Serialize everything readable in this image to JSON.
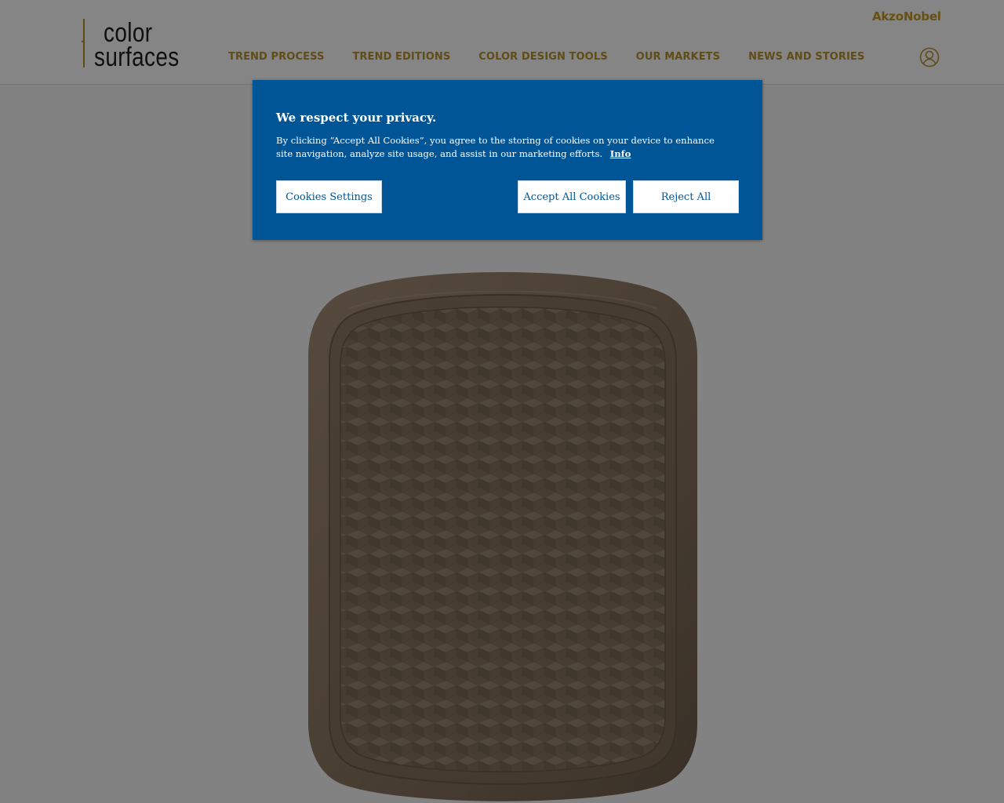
{
  "header": {
    "logo": {
      "line1": "color",
      "line2": "surfaces"
    },
    "brand": "AkzoNobel",
    "nav": [
      {
        "label": "TREND PROCESS"
      },
      {
        "label": "TREND EDITIONS"
      },
      {
        "label": "COLOR DESIGN TOOLS"
      },
      {
        "label": "OUR MARKETS"
      },
      {
        "label": "NEWS AND STORIES"
      }
    ],
    "icons": {
      "account": "user-circle-icon"
    }
  },
  "cookie": {
    "title": "We respect your privacy.",
    "text": "By clicking “Accept All Cookies”, you agree to the storing of cookies on your device to enhance site navigation, analyze site usage, and assist in our marketing efforts.",
    "info": "Info",
    "buttons": {
      "settings": "Cookies Settings",
      "accept": "Accept All Cookies",
      "reject": "Reject All"
    }
  },
  "colors": {
    "accent": "#b9932d",
    "brand": "#c79a22",
    "banner": "#005596",
    "tray": "#8f7a63"
  }
}
